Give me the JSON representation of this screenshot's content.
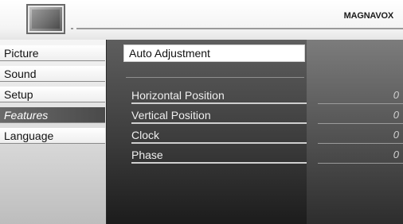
{
  "header": {
    "brand": "MAGNAVOX",
    "logo_icon": "tv-icon"
  },
  "menu": {
    "items": [
      {
        "label": "Picture",
        "selected": false
      },
      {
        "label": "Sound",
        "selected": false
      },
      {
        "label": "Setup",
        "selected": false
      },
      {
        "label": "Features",
        "selected": true
      },
      {
        "label": "Language",
        "selected": false
      }
    ]
  },
  "features": {
    "highlighted": "Auto Adjustment",
    "rows": [
      {
        "label": "Horizontal Position",
        "value": "0"
      },
      {
        "label": "Vertical Position",
        "value": "0"
      },
      {
        "label": "Clock",
        "value": "0"
      },
      {
        "label": "Phase",
        "value": "0"
      }
    ]
  },
  "colors": {
    "selected_menu_bg": "#5a5a5a",
    "panel_dark": "#3c3c3c",
    "highlight_bg": "#ffffff"
  }
}
